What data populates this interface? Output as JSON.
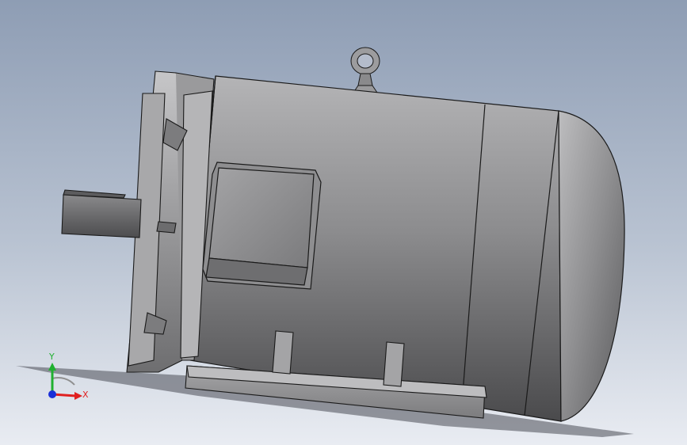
{
  "viewport": {
    "background_top": "#8e9db4",
    "background_bottom": "#e9ecf2"
  },
  "model": {
    "parts": [
      "eye-bolt",
      "motor-housing",
      "end-cap",
      "front-flange",
      "shaft",
      "terminal-box",
      "mounting-feet",
      "ground-shadow"
    ],
    "body_color": "#a9a9ab",
    "edge_color": "#1a1a1a"
  },
  "triad": {
    "x_label": "X",
    "y_label": "Y",
    "x_color": "#e02020",
    "y_color": "#20b030",
    "z_color": "#1a2fd8"
  }
}
